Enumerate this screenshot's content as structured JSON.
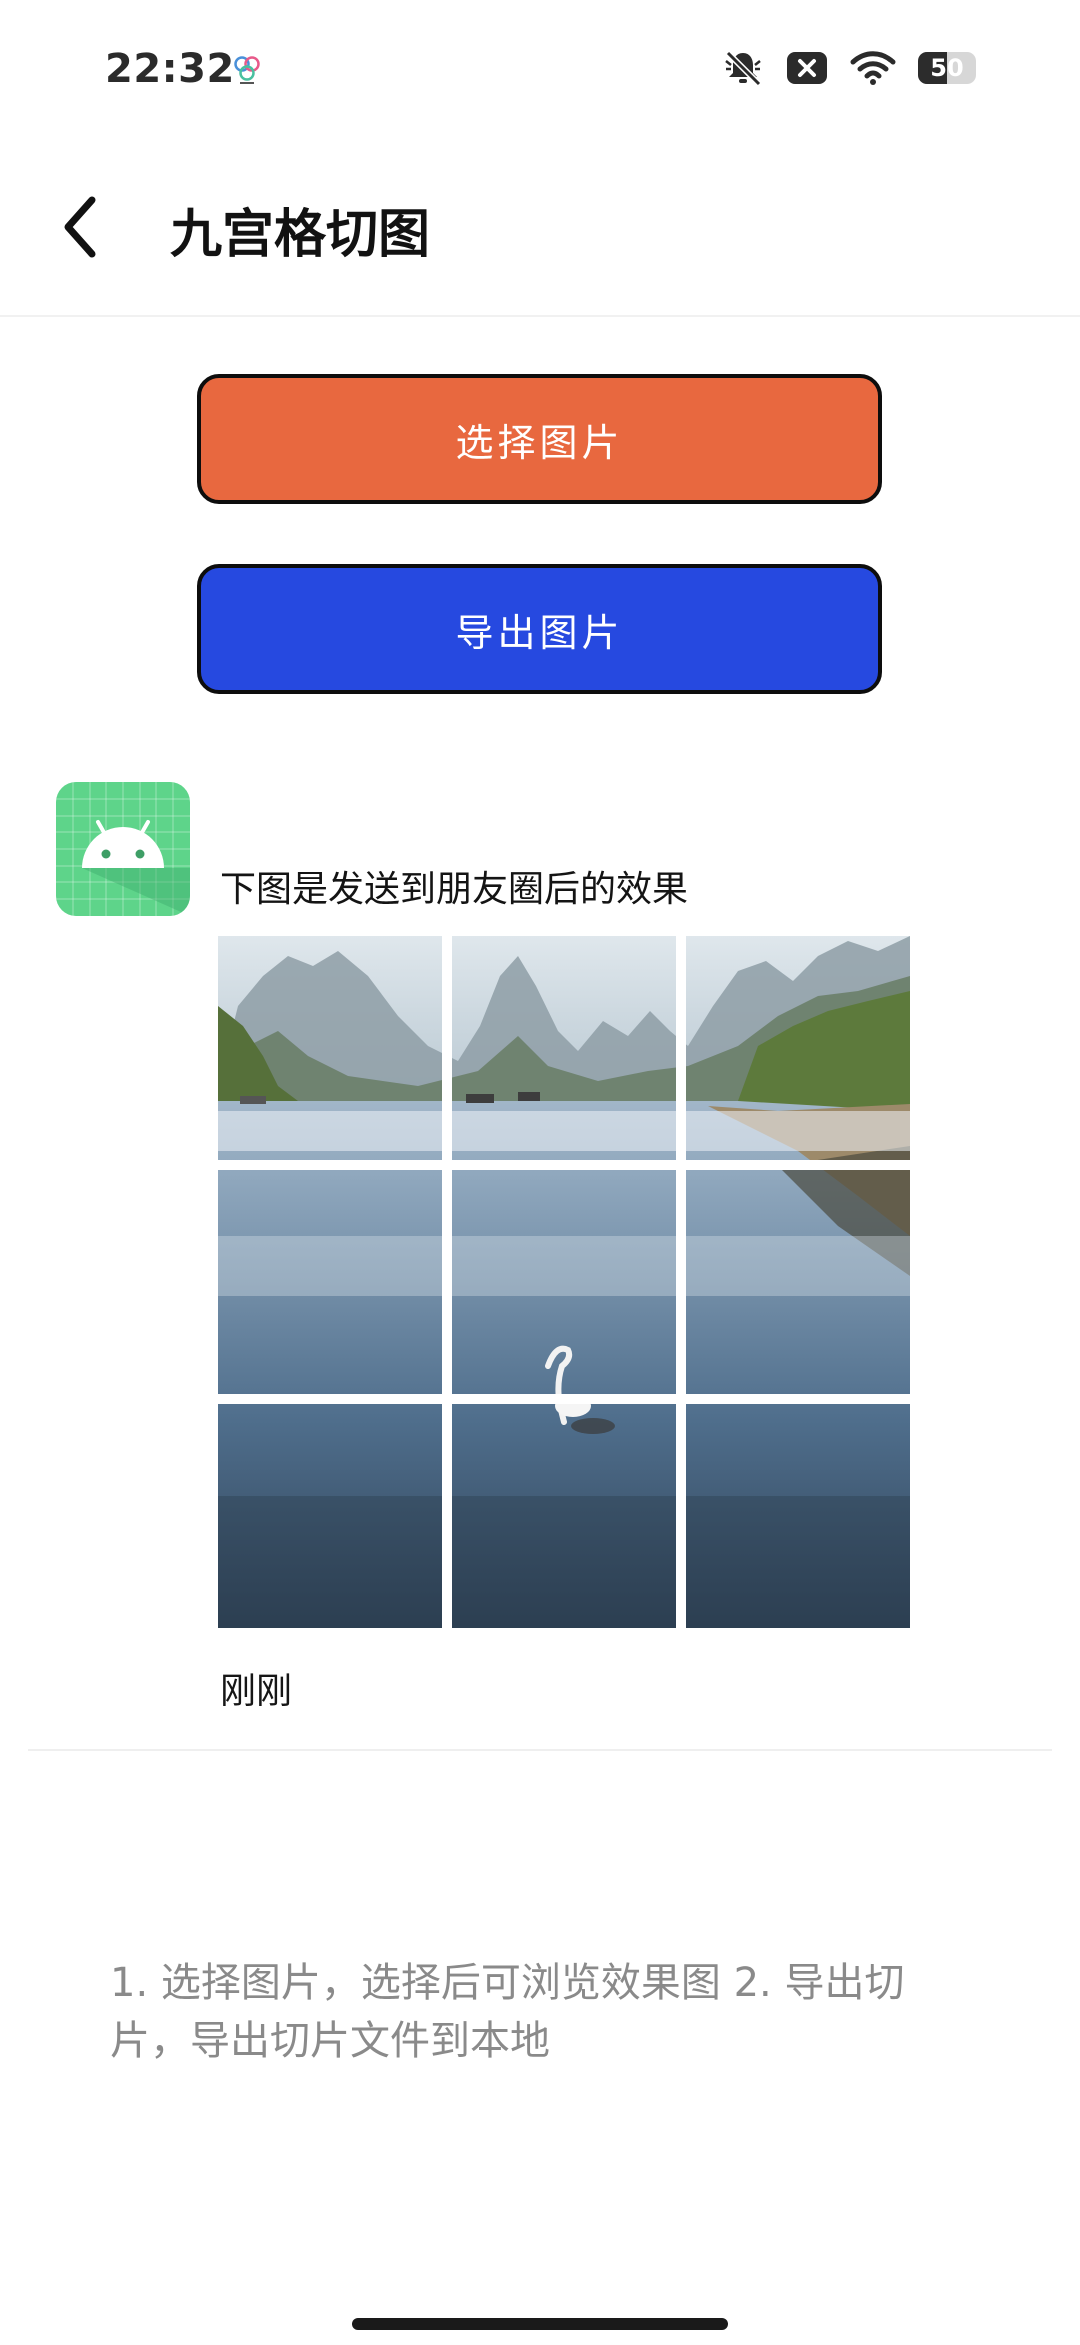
{
  "status_bar": {
    "time": "22:32",
    "app_icon": "clover-icon",
    "icons": [
      "bell-muted-icon",
      "close-box-icon",
      "wifi-icon",
      "battery-icon"
    ],
    "battery_level": "50",
    "battery_fraction": 0.5
  },
  "header": {
    "back_icon": "chevron-left-icon",
    "title": "九宫格切图"
  },
  "actions": {
    "select_label": "选择图片",
    "select_color": "#E8683F",
    "export_label": "导出图片",
    "export_color": "#2649E0"
  },
  "preview": {
    "avatar_icon": "android-icon",
    "avatar_color": "#5ED48A",
    "caption": "下图是发送到朋友圈后的效果",
    "grid_rows": 3,
    "grid_cols": 3,
    "timestamp": "刚刚"
  },
  "instructions": "1. 选择图片，选择后可浏览效果图 2. 导出切片，导出切片文件到本地"
}
